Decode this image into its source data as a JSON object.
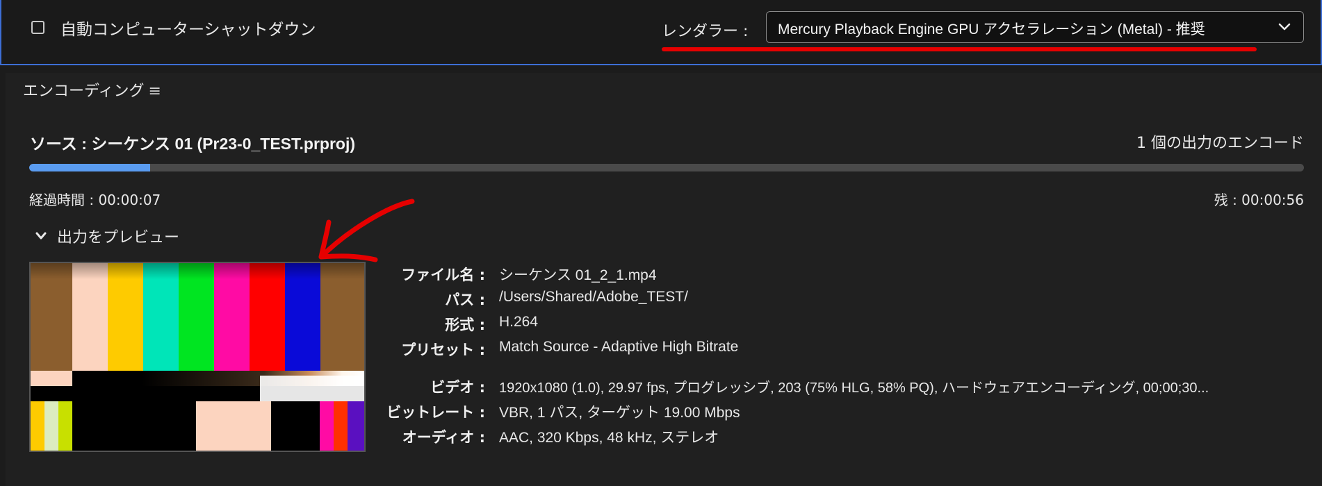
{
  "header": {
    "auto_shutdown_label": "自動コンピューターシャットダウン",
    "auto_shutdown_checked": false,
    "renderer_label": "レンダラー :",
    "renderer_value": "Mercury Playback Engine GPU アクセラレーション (Metal) - 推奨"
  },
  "encoding": {
    "panel_title": "エンコーディング",
    "source_title": "ソース : シーケンス 01 (Pr23-0_TEST.prproj)",
    "output_count": "1 個の出力のエンコード",
    "progress": 0.095,
    "elapsed": "経過時間 : 00:00:07",
    "remaining": "残 : 00:00:56",
    "preview_toggle": "出力をプレビュー"
  },
  "details": {
    "file_label": "ファイル名 :",
    "file_value": "シーケンス 01_2_1.mp4",
    "path_label": "パス :",
    "path_value": "/Users/Shared/Adobe_TEST/",
    "format_label": "形式 :",
    "format_value": "H.264",
    "preset_label": "プリセット :",
    "preset_value": "Match Source - Adaptive High Bitrate",
    "video_label": "ビデオ :",
    "video_value": "1920x1080 (1.0), 29.97 fps, プログレッシブ, 203 (75% HLG, 58% PQ), ハードウェアエンコーディング, 00;00;30...",
    "bitrate_label": "ビットレート :",
    "bitrate_value": "VBR, 1 パス, ターゲット 19.00 Mbps",
    "audio_label": "オーディオ :",
    "audio_value": "AAC, 320 Kbps, 48 kHz, ステレオ"
  },
  "colors": {
    "accent_blue": "#5a9cf0",
    "annotation_red": "#e60000",
    "window_border": "#3d6fd6"
  }
}
